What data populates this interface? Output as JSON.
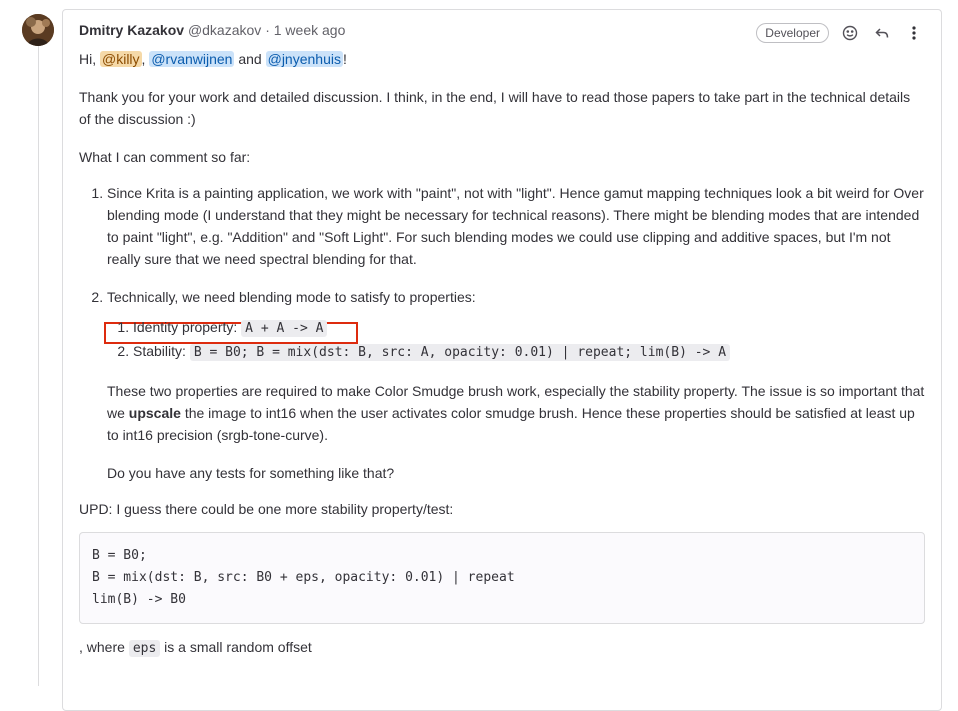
{
  "comment": {
    "author": "Dmitry Kazakov",
    "handle": "@dkazakov",
    "separator": "·",
    "time": "1 week ago",
    "role_badge": "Developer",
    "greeting": {
      "hi": "Hi, ",
      "mention1": "@killy",
      "comma": ", ",
      "mention2": "@rvanwijnen",
      "and": " and ",
      "mention3": "@jnyenhuis",
      "end": "!"
    },
    "para1": "Thank you for your work and detailed discussion. I think, in the end, I will have to read those papers to take part in the technical details of the discussion :)",
    "para2": "What I can comment so far:",
    "item1": "Since Krita is a painting application, we work with \"paint\", not with \"light\". Hence gamut mapping techniques look a bit weird for Over blending mode (I understand that they might be necessary for technical reasons). There might be blending modes that are intended to paint \"light\", e.g. \"Addition\" and \"Soft Light\". For such blending modes we could use clipping and additive spaces, but I'm not really sure that we need spectral blending for that.",
    "item2_intro": "Technically, we need blending mode to satisfy to properties:",
    "sub1_label": "Identity property: ",
    "sub1_code": "A + A -> A",
    "sub2_label": "Stability: ",
    "sub2_code": "B = B0; B = mix(dst: B, src: A, opacity: 0.01) | repeat; lim(B) -> A",
    "item2_p1_a": "These two properties are required to make Color Smudge brush work, especially the stability property. The issue is so important that we ",
    "item2_p1_bold": "upscale",
    "item2_p1_b": " the image to int16 when the user activates color smudge brush. Hence these properties should be satisfied at least up to int16 precision (srgb-tone-curve).",
    "item2_p2": "Do you have any tests for something like that?",
    "upd": "UPD: I guess there could be one more stability property/test:",
    "code_block": "B = B0;\nB = mix(dst: B, src: B0 + eps, opacity: 0.01) | repeat\nlim(B) -> B0",
    "last_a": ", where ",
    "last_code": "eps",
    "last_b": " is a small random offset"
  },
  "icons": {
    "avatar": "avatar-image",
    "emoji": "smiley-icon",
    "reply": "reply-icon",
    "more": "more-vertical-icon"
  }
}
